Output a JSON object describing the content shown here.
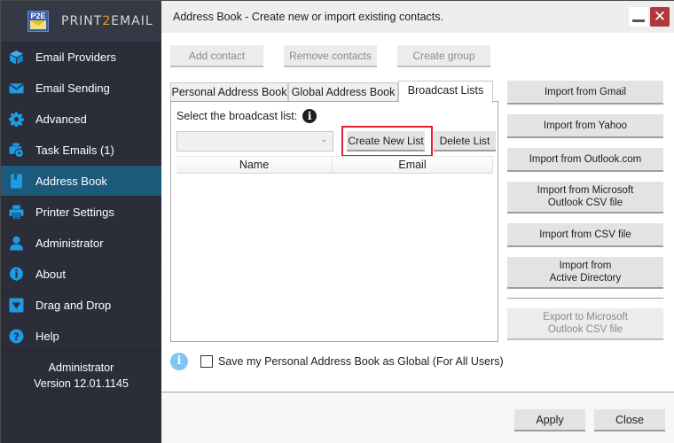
{
  "app": {
    "brand_prefix": "PRINT",
    "brand_two": "2",
    "brand_suffix": "EMAIL",
    "logo_text": "P2E"
  },
  "sidebar": {
    "items": [
      {
        "label": "Email Providers",
        "icon": "cube-icon",
        "active": false
      },
      {
        "label": "Email Sending",
        "icon": "envelope-icon",
        "active": false
      },
      {
        "label": "Advanced",
        "icon": "gear-icon",
        "active": false
      },
      {
        "label": "Task Emails (1)",
        "icon": "printer-clock-icon",
        "active": false
      },
      {
        "label": "Address Book",
        "icon": "address-book-icon",
        "active": true
      },
      {
        "label": "Printer Settings",
        "icon": "printer-icon",
        "active": false
      },
      {
        "label": "Administrator",
        "icon": "user-icon",
        "active": false
      },
      {
        "label": "About",
        "icon": "info-icon",
        "active": false
      },
      {
        "label": "Drag and Drop",
        "icon": "drop-down-icon",
        "active": false
      },
      {
        "label": "Help",
        "icon": "help-icon",
        "active": false
      }
    ],
    "footer_user": "Administrator",
    "footer_version": "Version 12.01.1145"
  },
  "colors": {
    "accent": "#1e9be6",
    "active_item": "#1c5a7c",
    "sidebar_bg": "#2b2e38",
    "close_button": "#b0383a",
    "highlight": "#e3202e"
  },
  "titlebar": {
    "title": "Address Book - Create new or import existing contacts.",
    "minimize_glyph": "_",
    "close_glyph": "✕"
  },
  "toolbar": {
    "add_contact": "Add contact",
    "remove_contacts": "Remove contacts",
    "create_group": "Create group"
  },
  "tabs": [
    {
      "label": "Personal Address Book",
      "active": false
    },
    {
      "label": "Global Address Book",
      "active": false
    },
    {
      "label": "Broadcast Lists",
      "active": true
    }
  ],
  "broadcast": {
    "select_label": "Select the broadcast list:",
    "selected_value": "",
    "create_new_list": "Create New List",
    "delete_list": "Delete List",
    "columns": [
      "Name",
      "Email"
    ],
    "rows": []
  },
  "imports": {
    "gmail": "Import from Gmail",
    "yahoo": "Import from Yahoo",
    "outlook_com": "Import from Outlook.com",
    "ms_outlook_csv_1": "Import from Microsoft",
    "ms_outlook_csv_2": "Outlook CSV file",
    "csv": "Import from CSV file",
    "ad_1": "Import from",
    "ad_2": "Active Directory",
    "export_1": "Export to Microsoft",
    "export_2": "Outlook CSV file"
  },
  "global_option": {
    "label": "Save my Personal Address Book as Global (For All Users)",
    "checked": false
  },
  "footer": {
    "apply": "Apply",
    "close": "Close"
  }
}
